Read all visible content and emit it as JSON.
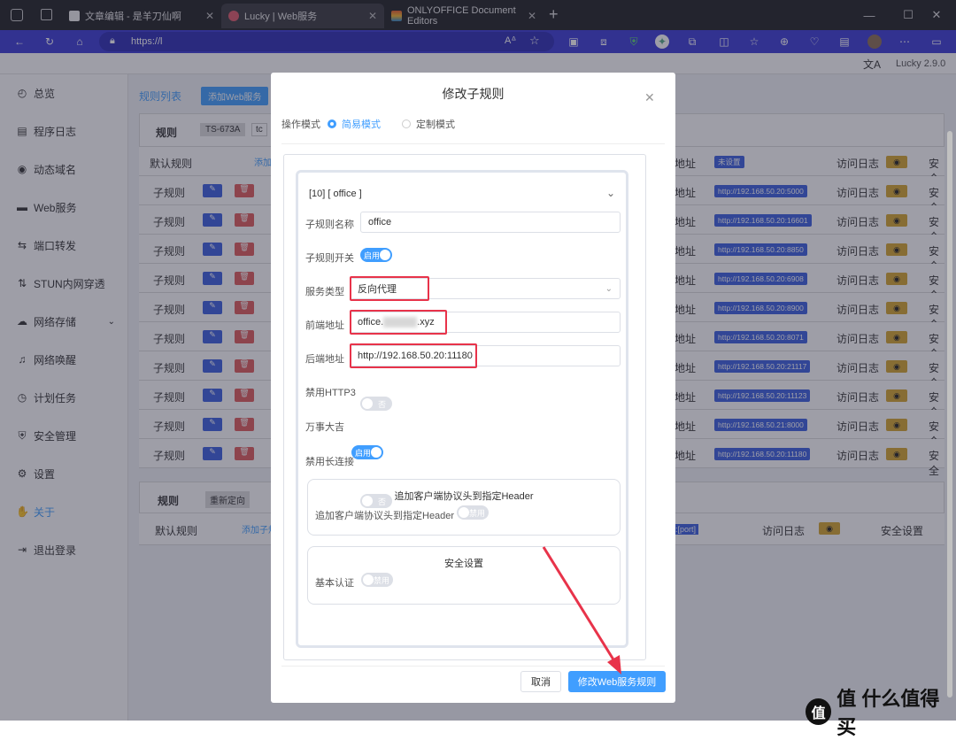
{
  "browser": {
    "tabs": [
      {
        "title": "文章编辑 - 是羊刀仙啊"
      },
      {
        "title": "Lucky | Web服务"
      },
      {
        "title": "ONLYOFFICE Document Editors"
      }
    ],
    "url": "https://l"
  },
  "app": {
    "version": "Lucky 2.9.0",
    "sidebar": [
      {
        "label": "总览",
        "icon": "dashboard-icon"
      },
      {
        "label": "程序日志",
        "icon": "log-icon"
      },
      {
        "label": "动态域名",
        "icon": "ddns-icon"
      },
      {
        "label": "Web服务",
        "icon": "web-icon"
      },
      {
        "label": "端口转发",
        "icon": "port-forward-icon"
      },
      {
        "label": "STUN内网穿透",
        "icon": "stun-icon"
      },
      {
        "label": "网络存储",
        "icon": "storage-icon"
      },
      {
        "label": "网络唤醒",
        "icon": "wake-icon"
      },
      {
        "label": "计划任务",
        "icon": "schedule-icon"
      },
      {
        "label": "安全管理",
        "icon": "security-icon"
      },
      {
        "label": "设置",
        "icon": "settings-icon"
      },
      {
        "label": "关于",
        "icon": "about-icon"
      },
      {
        "label": "退出登录",
        "icon": "logout-icon"
      }
    ],
    "content": {
      "tab_rules": "规则列表",
      "tab_add": "添加Web服务",
      "rule_label": "规则",
      "rule_tag": "TS-673A",
      "rule_proto": "tc",
      "default_rule": "默认规则",
      "add_sub": "添加",
      "addr_col": "地址",
      "not_set": "未设置",
      "access_log": "访问日志",
      "security_short": "安全",
      "subrule": "子规则",
      "backend_urls": [
        "http://192.168.50.20:5000",
        "http://192.168.50.20:16601",
        "http://192.168.50.20:8850",
        "http://192.168.50.20:6908",
        "http://192.168.50.20:8900",
        "http://192.168.50.20:8071",
        "http://192.168.50.20:21117",
        "http://192.168.50.20:11123",
        "http://192.168.50.21:8000",
        "http://192.168.50.20:11180"
      ],
      "rule2_label": "规则",
      "rule2_tag": "重新定向",
      "add_sub2": "添加子规",
      "port_text": "t]:[port]",
      "security_settings": "安全设置"
    }
  },
  "modal": {
    "title": "修改子规则",
    "mode_label": "操作模式",
    "mode_simple": "简易模式",
    "mode_custom": "定制模式",
    "collapse_title": "[10] [ office ]",
    "fields": {
      "name_label": "子规则名称",
      "name_value": "office",
      "switch_label": "子规则开关",
      "switch_text": "启用",
      "service_type_label": "服务类型",
      "service_type_value": "反向代理",
      "frontend_label": "前端地址",
      "frontend_value_prefix": "office.",
      "frontend_value_suffix": ".xyz",
      "backend_label": "后端地址",
      "backend_value": "http://192.168.50.20:11180",
      "http3_label": "禁用HTTP3",
      "http3_text": "否",
      "lucky_label": "万事大吉",
      "lucky_text": "启用",
      "keepalive_label": "禁用长连接",
      "keepalive_text": "否"
    },
    "header_section": {
      "title": "追加客户端协议头到指定Header",
      "label": "追加客户端协议头到指定Header",
      "toggle_text": "禁用"
    },
    "security_section": {
      "title": "安全设置",
      "label": "基本认证",
      "toggle_text": "禁用"
    },
    "cancel": "取消",
    "submit": "修改Web服务规则"
  },
  "watermark": "值 什么值得买",
  "colors": {
    "accent": "#409eff",
    "highlight": "#e8334a",
    "toolbar": "#3b3bd6"
  }
}
